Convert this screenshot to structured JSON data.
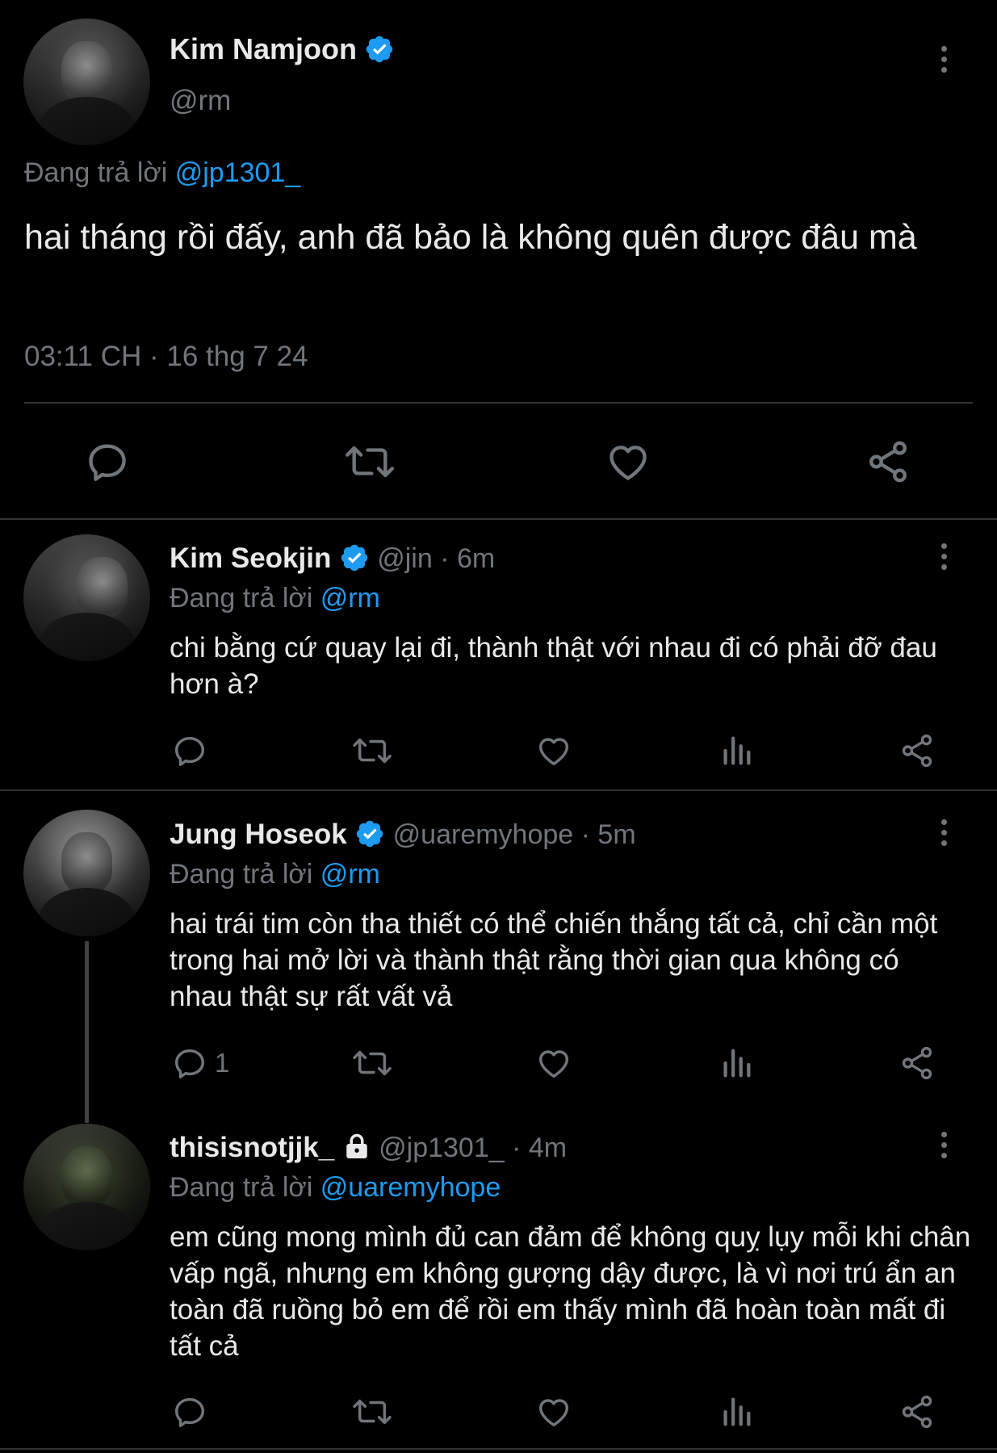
{
  "main_tweet": {
    "display_name": "Kim Namjoon",
    "handle": "@rm",
    "replying_to_prefix": "Đang trả lời",
    "replying_to": "@jp1301_",
    "text": "hai tháng rồi đấy, anh đã bảo là không quên được đâu mà",
    "timestamp": "03:11 CH · 16 thg 7 24"
  },
  "replies": [
    {
      "display_name": "Kim Seokjin",
      "handle": "@jin",
      "time": "· 6m",
      "replying_to_prefix": "Đang trả lời",
      "replying_to": "@rm",
      "text": "chi bằng cứ quay lại đi, thành thật với nhau đi có phải đỡ đau hơn à?",
      "reply_count": ""
    },
    {
      "display_name": "Jung Hoseok",
      "handle": "@uaremyhope",
      "time": "· 5m",
      "replying_to_prefix": "Đang trả lời",
      "replying_to": "@rm",
      "text": "hai trái tim còn tha thiết có thể chiến thắng tất cả, chỉ cần một trong hai mở lời và thành thật rằng thời gian qua không có nhau thật sự rất vất vả",
      "reply_count": "1"
    },
    {
      "display_name": "thisisnotjjk_",
      "handle": "@jp1301_",
      "time": "· 4m",
      "replying_to_prefix": "Đang trả lời",
      "replying_to": "@uaremyhope",
      "text": "em cũng mong mình đủ can đảm để không quỵ lụy mỗi khi chân vấp ngã, nhưng em không gượng dậy được, là vì nơi trú ẩn an toàn đã ruồng bỏ em để rồi em thấy mình đã hoàn toàn mất đi tất cả",
      "reply_count": ""
    }
  ],
  "colors": {
    "background": "#000000",
    "text": "#e7e9ea",
    "muted": "#71767b",
    "link": "#1d9bf0",
    "divider": "#2f3336"
  },
  "icons": [
    "verified-badge-icon",
    "lock-icon",
    "more-options-icon",
    "reply-icon",
    "retweet-icon",
    "like-icon",
    "share-icon",
    "views-icon"
  ]
}
